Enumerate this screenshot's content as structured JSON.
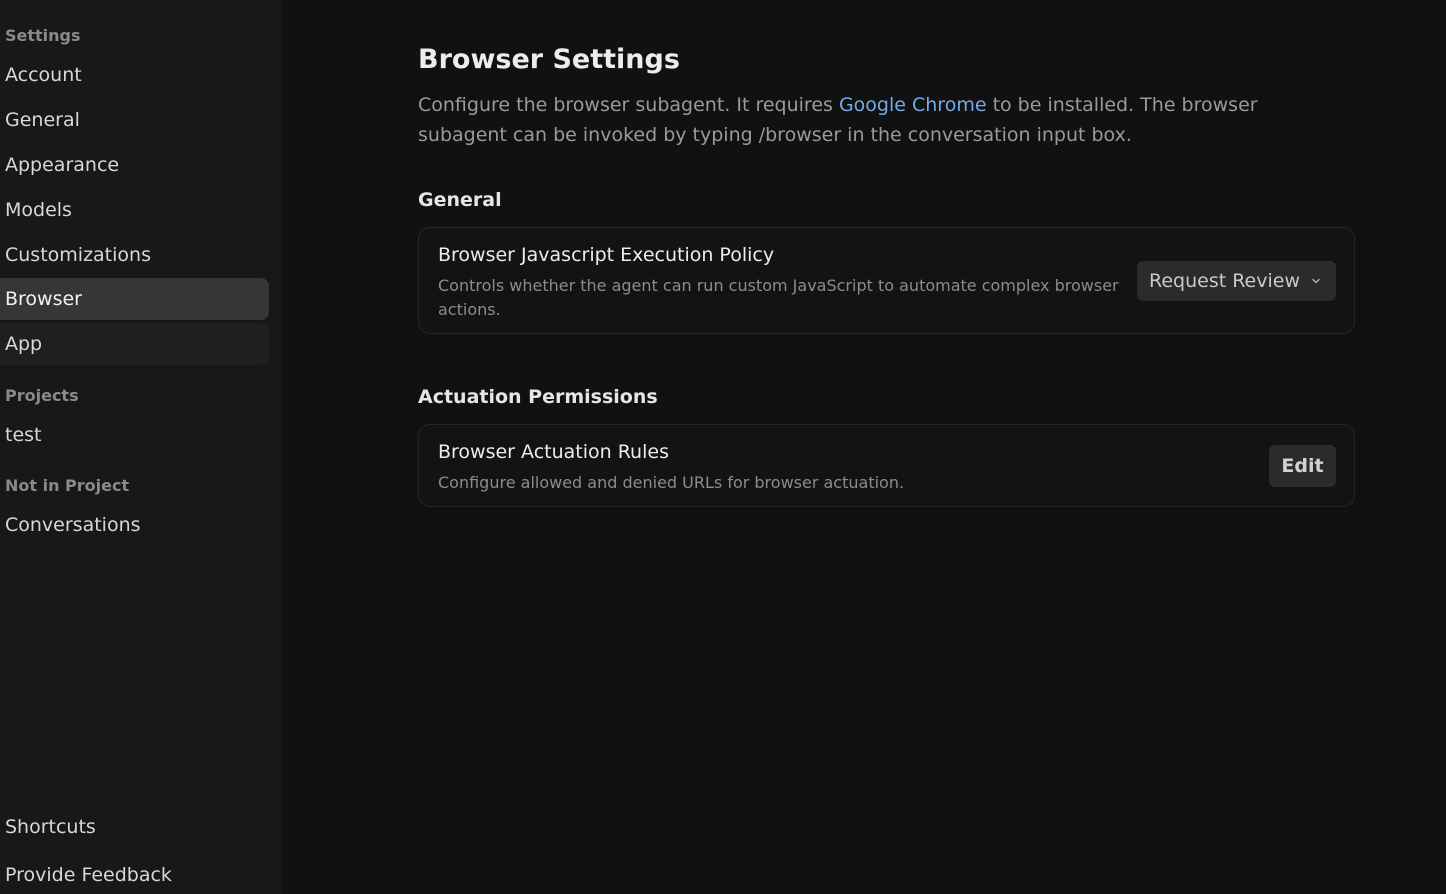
{
  "sidebar": {
    "settings_label": "Settings",
    "items": [
      {
        "label": "Account"
      },
      {
        "label": "General"
      },
      {
        "label": "Appearance"
      },
      {
        "label": "Models"
      },
      {
        "label": "Customizations"
      },
      {
        "label": "Browser"
      },
      {
        "label": "App"
      }
    ],
    "projects_label": "Projects",
    "projects": [
      {
        "label": "test"
      }
    ],
    "not_in_project_label": "Not in Project",
    "conversations_label": "Conversations",
    "shortcuts_label": "Shortcuts",
    "feedback_label": "Provide Feedback",
    "active_item": "Browser"
  },
  "main": {
    "title": "Browser Settings",
    "description_before": "Configure the browser subagent. It requires ",
    "description_link": "Google Chrome",
    "description_after": " to be installed. The browser subagent can be invoked by typing /browser in the conversation input box.",
    "general_title": "General",
    "js_policy": {
      "title": "Browser Javascript Execution Policy",
      "description": "Controls whether the agent can run custom JavaScript to automate complex browser actions.",
      "selected_value": "Request Review"
    },
    "actuation_title": "Actuation Permissions",
    "actuation_rules": {
      "title": "Browser Actuation Rules",
      "description": "Configure allowed and denied URLs for browser actuation.",
      "button_label": "Edit"
    }
  },
  "colors": {
    "background": "#111111",
    "sidebar": "#181818",
    "active_item": "#363636",
    "link": "#73a9e8"
  }
}
